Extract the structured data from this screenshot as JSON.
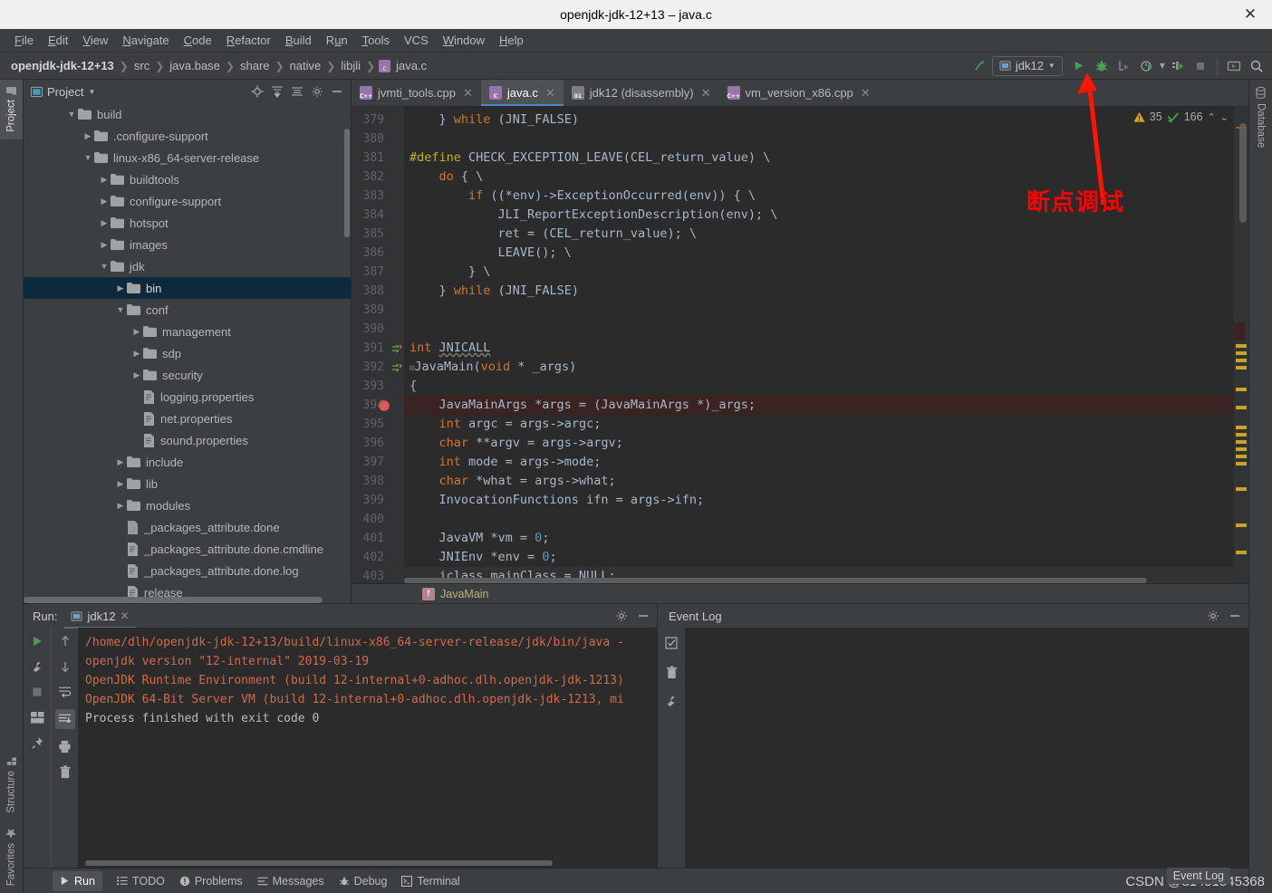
{
  "window": {
    "title": "openjdk-jdk-12+13 – java.c",
    "close_label": "✕"
  },
  "menubar": {
    "items": [
      "File",
      "Edit",
      "View",
      "Navigate",
      "Code",
      "Refactor",
      "Build",
      "Run",
      "Tools",
      "VCS",
      "Window",
      "Help"
    ]
  },
  "navbar": {
    "breadcrumbs": [
      "openjdk-jdk-12+13",
      "src",
      "java.base",
      "share",
      "native",
      "libjli",
      "java.c"
    ],
    "run_config": "jdk12",
    "icons": [
      "build-icon",
      "run-icon",
      "debug-icon",
      "run-with-coverage-icon",
      "profile-icon",
      "attach-icon",
      "stop-icon",
      "layout-icon",
      "search-icon"
    ]
  },
  "left_rail": {
    "top": [
      "Project"
    ],
    "bottom": [
      "Structure",
      "Favorites"
    ]
  },
  "right_rail": {
    "items": [
      "Database"
    ]
  },
  "project_panel": {
    "title": "Project",
    "actions": [
      "locate-icon",
      "expand-all-icon",
      "collapse-all-icon",
      "gear-icon",
      "minimize-icon"
    ],
    "tree": [
      {
        "label": "build",
        "depth": 1,
        "type": "folder",
        "twist": "open",
        "selected": false
      },
      {
        "label": ".configure-support",
        "depth": 2,
        "type": "folder",
        "twist": "closed",
        "selected": false
      },
      {
        "label": "linux-x86_64-server-release",
        "depth": 2,
        "type": "folder",
        "twist": "open",
        "selected": false
      },
      {
        "label": "buildtools",
        "depth": 3,
        "type": "folder",
        "twist": "closed",
        "selected": false
      },
      {
        "label": "configure-support",
        "depth": 3,
        "type": "folder",
        "twist": "closed",
        "selected": false
      },
      {
        "label": "hotspot",
        "depth": 3,
        "type": "folder",
        "twist": "closed",
        "selected": false
      },
      {
        "label": "images",
        "depth": 3,
        "type": "folder",
        "twist": "closed",
        "selected": false
      },
      {
        "label": "jdk",
        "depth": 3,
        "type": "folder",
        "twist": "open",
        "selected": false
      },
      {
        "label": "bin",
        "depth": 4,
        "type": "folder",
        "twist": "closed",
        "selected": true
      },
      {
        "label": "conf",
        "depth": 4,
        "type": "folder",
        "twist": "open",
        "selected": false
      },
      {
        "label": "management",
        "depth": 5,
        "type": "folder",
        "twist": "closed",
        "selected": false
      },
      {
        "label": "sdp",
        "depth": 5,
        "type": "folder",
        "twist": "closed",
        "selected": false
      },
      {
        "label": "security",
        "depth": 5,
        "type": "folder",
        "twist": "closed",
        "selected": false
      },
      {
        "label": "logging.properties",
        "depth": 5,
        "type": "file",
        "twist": "none",
        "selected": false
      },
      {
        "label": "net.properties",
        "depth": 5,
        "type": "file",
        "twist": "none",
        "selected": false
      },
      {
        "label": "sound.properties",
        "depth": 5,
        "type": "file",
        "twist": "none",
        "selected": false
      },
      {
        "label": "include",
        "depth": 4,
        "type": "folder",
        "twist": "closed",
        "selected": false
      },
      {
        "label": "lib",
        "depth": 4,
        "type": "folder",
        "twist": "closed",
        "selected": false
      },
      {
        "label": "modules",
        "depth": 4,
        "type": "folder",
        "twist": "closed",
        "selected": false
      },
      {
        "label": "_packages_attribute.done",
        "depth": 4,
        "type": "file-unknown",
        "twist": "none",
        "selected": false
      },
      {
        "label": "_packages_attribute.done.cmdline",
        "depth": 4,
        "type": "file",
        "twist": "none",
        "selected": false
      },
      {
        "label": "_packages_attribute.done.log",
        "depth": 4,
        "type": "file",
        "twist": "none",
        "selected": false
      },
      {
        "label": "release",
        "depth": 4,
        "type": "file",
        "twist": "none",
        "selected": false
      }
    ]
  },
  "editor": {
    "tabs": [
      {
        "label": "jvmti_tools.cpp",
        "icon": "cpp-file-icon",
        "icon_text": "C++",
        "color": "#9876aa",
        "active": false
      },
      {
        "label": "java.c",
        "icon": "c-file-icon",
        "icon_text": "C",
        "color": "#9876aa",
        "active": true
      },
      {
        "label": "jdk12 (disassembly)",
        "icon": "disassembly-icon",
        "icon_text": "01",
        "color": "#7f7f7f",
        "active": false
      },
      {
        "label": "vm_version_x86.cpp",
        "icon": "cpp-file-icon",
        "icon_text": "C++",
        "color": "#9876aa",
        "active": false
      }
    ],
    "inspections": {
      "warning_count": "35",
      "weak_warning_count": "166"
    },
    "breadcrumb": {
      "icon_text": "f",
      "label": "JavaMain"
    },
    "first_line_number": 379,
    "lines": [
      {
        "n": 379,
        "text": "    } while (JNI_FALSE)",
        "kw": [
          "while"
        ]
      },
      {
        "n": 380,
        "text": ""
      },
      {
        "n": 381,
        "text": "#define CHECK_EXCEPTION_LEAVE(CEL_return_value) \\",
        "macro": true
      },
      {
        "n": 382,
        "text": "    do { \\",
        "kw": [
          "do"
        ]
      },
      {
        "n": 383,
        "text": "        if ((*env)->ExceptionOccurred(env)) { \\",
        "kw": [
          "if"
        ]
      },
      {
        "n": 384,
        "text": "            JLI_ReportExceptionDescription(env); \\"
      },
      {
        "n": 385,
        "text": "            ret = (CEL_return_value); \\"
      },
      {
        "n": 386,
        "text": "            LEAVE(); \\"
      },
      {
        "n": 387,
        "text": "        } \\"
      },
      {
        "n": 388,
        "text": "    } while (JNI_FALSE)",
        "kw": [
          "while"
        ]
      },
      {
        "n": 389,
        "text": ""
      },
      {
        "n": 390,
        "text": ""
      },
      {
        "n": 391,
        "text": "int JNICALL",
        "kw": [
          "int"
        ],
        "mark": "override-icon"
      },
      {
        "n": 392,
        "text": "JavaMain(void * _args)",
        "kw": [
          "void"
        ],
        "mark": "override-icon",
        "fold": true
      },
      {
        "n": 393,
        "text": "{"
      },
      {
        "n": 394,
        "text": "    JavaMainArgs *args = (JavaMainArgs *)_args;",
        "breakpoint": true
      },
      {
        "n": 395,
        "text": "    int argc = args->argc;",
        "kw": [
          "int"
        ]
      },
      {
        "n": 396,
        "text": "    char **argv = args->argv;",
        "kw": [
          "char"
        ]
      },
      {
        "n": 397,
        "text": "    int mode = args->mode;",
        "kw": [
          "int"
        ]
      },
      {
        "n": 398,
        "text": "    char *what = args->what;",
        "kw": [
          "char"
        ]
      },
      {
        "n": 399,
        "text": "    InvocationFunctions ifn = args->ifn;"
      },
      {
        "n": 400,
        "text": ""
      },
      {
        "n": 401,
        "text": "    JavaVM *vm = 0;"
      },
      {
        "n": 402,
        "text": "    JNIEnv *env = 0;"
      },
      {
        "n": 403,
        "text": "    jclass mainClass = NULL;",
        "caret": true
      }
    ]
  },
  "run_panel": {
    "label": "Run:",
    "tab": "jdk12",
    "actions": [
      "gear-icon",
      "minimize-icon"
    ],
    "left_icons": [
      "rerun-icon",
      "wrench-icon",
      "stop-icon",
      "layout-icon",
      "pin-icon"
    ],
    "right_icons": [
      "up-icon",
      "down-icon",
      "soft-wrap-icon",
      "scroll-end-icon",
      "print-icon",
      "trash-icon"
    ],
    "console": [
      {
        "text": "/home/dlh/openjdk-jdk-12+13/build/linux-x86_64-server-release/jdk/bin/java -",
        "type": "err"
      },
      {
        "text": "openjdk version \"12-internal\" 2019-03-19",
        "type": "err"
      },
      {
        "text": "OpenJDK Runtime Environment (build 12-internal+0-adhoc.dlh.openjdk-jdk-1213)",
        "type": "err"
      },
      {
        "text": "OpenJDK 64-Bit Server VM (build 12-internal+0-adhoc.dlh.openjdk-jdk-1213, mi",
        "type": "err"
      },
      {
        "text": "",
        "type": "out"
      },
      {
        "text": "Process finished with exit code 0",
        "type": "out"
      }
    ]
  },
  "event_panel": {
    "title": "Event Log",
    "actions": [
      "gear-icon",
      "minimize-icon"
    ],
    "rail_icons": [
      "mark-read-icon",
      "trash-icon",
      "wrench-icon"
    ]
  },
  "statusbar": {
    "items": [
      {
        "label": "Run",
        "icon": "run-icon",
        "active": true
      },
      {
        "label": "TODO",
        "icon": "todo-icon",
        "active": false
      },
      {
        "label": "Problems",
        "icon": "problems-icon",
        "active": false
      },
      {
        "label": "Messages",
        "icon": "messages-icon",
        "active": false
      },
      {
        "label": "Debug",
        "icon": "debug-icon",
        "active": false
      },
      {
        "label": "Terminal",
        "icon": "terminal-icon",
        "active": false
      }
    ],
    "event_log_label": "Event Log"
  },
  "annotations": {
    "red_text": "断点调试",
    "arrow": "red-arrow-up",
    "watermark": "CSDN @d1451545368"
  },
  "colors": {
    "accent_blue": "#4a88c7",
    "selection": "#0d293e",
    "editor_bg": "#2b2b2b",
    "chrome_bg": "#3c3f41",
    "breakpoint_red": "#db5c5c",
    "annotation_red": "#ff0000",
    "console_err": "#cf6a4c",
    "warn_yellow": "#c9a227"
  }
}
